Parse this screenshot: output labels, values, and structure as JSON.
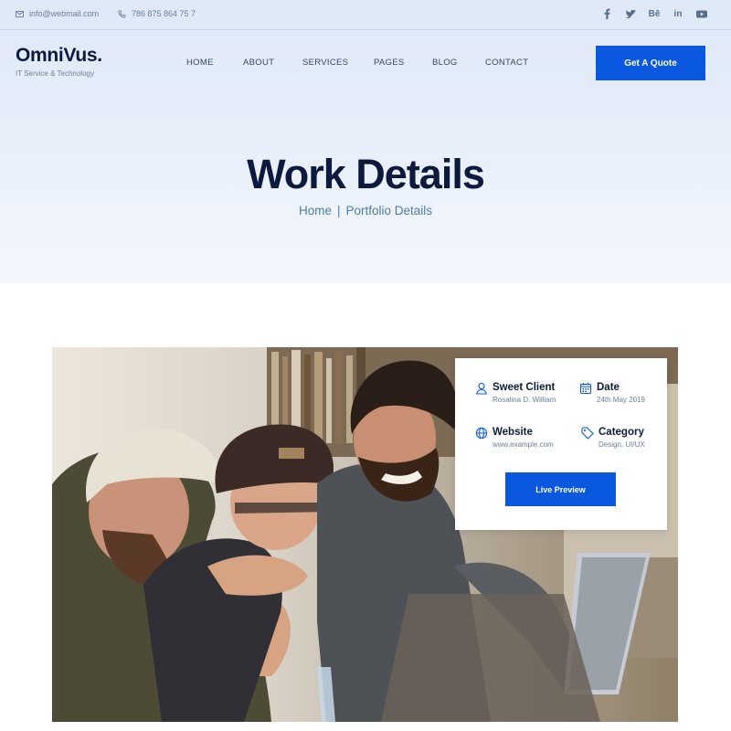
{
  "topbar": {
    "email": "info@webmail.com",
    "phone": "786 875 864 75 7",
    "social": [
      "facebook-icon",
      "twitter-icon",
      "behance-icon",
      "linkedin-icon",
      "youtube-icon"
    ],
    "behance_text": "Bē",
    "linkedin_text": "in"
  },
  "brand": {
    "name": "OmniVus.",
    "tagline": "IT Service & Technology"
  },
  "nav": {
    "items": [
      "HOME",
      "ABOUT",
      "SERVICES",
      "PAGES",
      "BLOG",
      "CONTACT"
    ]
  },
  "cta": {
    "quote_label": "Get A Quote"
  },
  "hero": {
    "title": "Work Details",
    "breadcrumb_home": "Home",
    "breadcrumb_sep": "|",
    "breadcrumb_current": "Portfolio Details"
  },
  "project": {
    "client_label": "Sweet Client",
    "client_value": "Rosalina D. William",
    "date_label": "Date",
    "date_value": "24th May 2019",
    "website_label": "Website",
    "website_value": "www.example.com",
    "category_label": "Category",
    "category_value": "Design, UI/UX",
    "preview_label": "Live Preview"
  },
  "colors": {
    "accent": "#0a57e0",
    "heading": "#0b1a3d",
    "breadcrumb": "#4d7ea6"
  }
}
